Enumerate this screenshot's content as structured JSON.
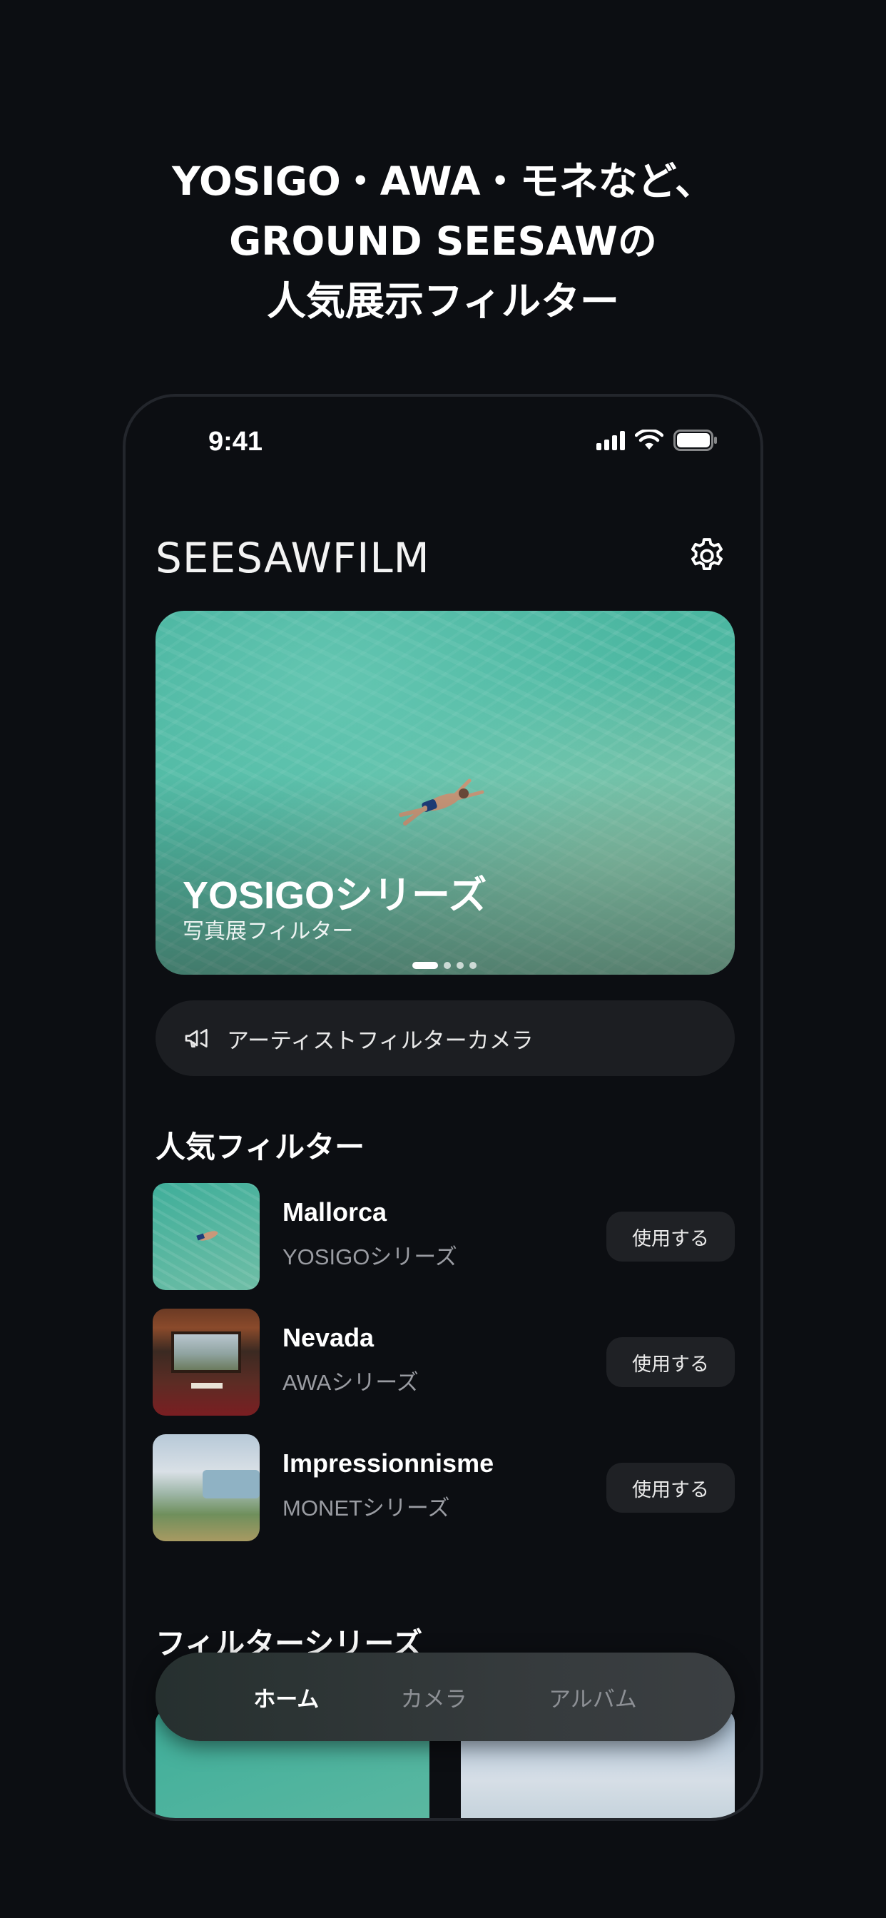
{
  "headline": {
    "line1": "YOSIGO・AWA・モネなど、",
    "line2": "GROUND SEESAWの",
    "line3": "人気展示フィルター"
  },
  "status_bar": {
    "time": "9:41"
  },
  "app": {
    "logo": "SEESAWFILM"
  },
  "hero": {
    "title": "YOSIGOシリーズ",
    "subtitle": "写真展フィルター",
    "page_count": 4,
    "active_page": 1
  },
  "artist_bar": {
    "label": "アーティストフィルターカメラ"
  },
  "popular": {
    "title": "人気フィルター",
    "items": [
      {
        "name": "Mallorca",
        "series": "YOSIGOシリーズ",
        "button": "使用する"
      },
      {
        "name": "Nevada",
        "series": "AWAシリーズ",
        "button": "使用する"
      },
      {
        "name": "Impressionnisme",
        "series": "MONETシリーズ",
        "button": "使用する"
      }
    ]
  },
  "series_section": {
    "title": "フィルターシリーズ"
  },
  "tabbar": {
    "tabs": [
      {
        "label": "ホーム",
        "active": true
      },
      {
        "label": "カメラ",
        "active": false
      },
      {
        "label": "アルバム",
        "active": false
      }
    ]
  },
  "colors": {
    "background": "#0c0e12",
    "card": "#1c1e22",
    "muted_text": "#9a9ca2",
    "sea_green": "#4cb7a1"
  },
  "icons": [
    "signal-icon",
    "wifi-icon",
    "battery-icon",
    "gear-icon",
    "megaphone-icon",
    "swimmer-figure"
  ]
}
